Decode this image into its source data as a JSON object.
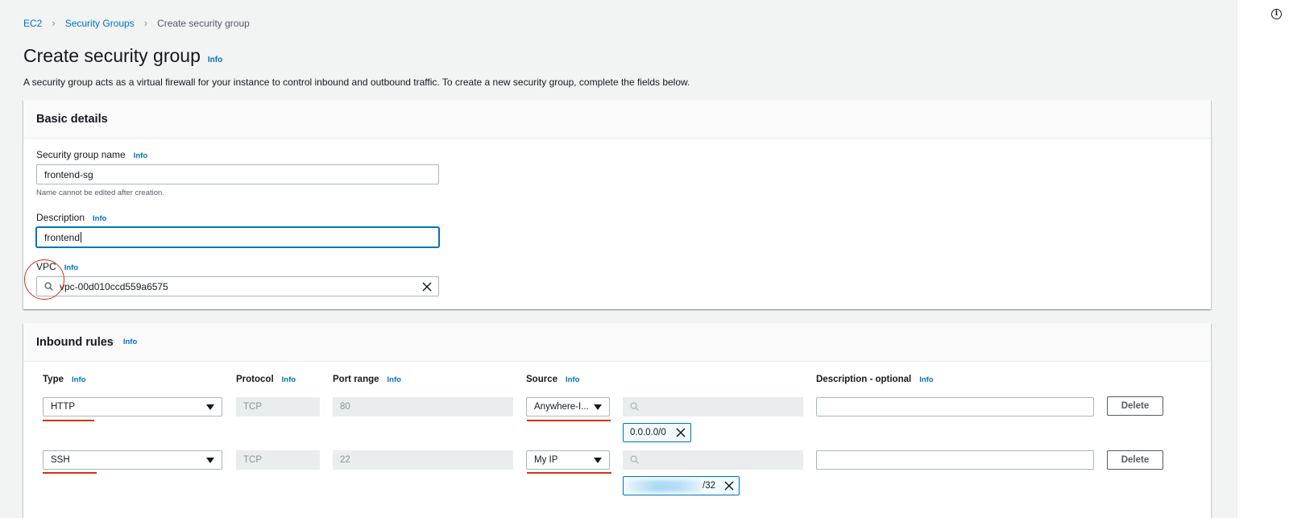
{
  "breadcrumb": {
    "items": [
      "EC2",
      "Security Groups"
    ],
    "current": "Create security group"
  },
  "page": {
    "title": "Create security group",
    "info": "Info",
    "description": "A security group acts as a virtual firewall for your instance to control inbound and outbound traffic. To create a new security group, complete the fields below."
  },
  "basic_details": {
    "heading": "Basic details",
    "name_label": "Security group name",
    "name_info": "Info",
    "name_value": "frontend-sg",
    "name_hint": "Name cannot be edited after creation.",
    "description_label": "Description",
    "description_info": "Info",
    "description_value": "frontend",
    "vpc_label": "VPC",
    "vpc_info": "Info",
    "vpc_value": "vpc-00d010ccd559a6575"
  },
  "inbound": {
    "heading": "Inbound rules",
    "info": "Info",
    "columns": {
      "type": "Type",
      "protocol": "Protocol",
      "port_range": "Port range",
      "source": "Source",
      "description": "Description - optional",
      "info": "Info"
    },
    "rules": [
      {
        "type": "HTTP",
        "protocol": "TCP",
        "port": "80",
        "source": "Anywhere-I...",
        "cidr": "0.0.0.0/0",
        "delete": "Delete"
      },
      {
        "type": "SSH",
        "protocol": "TCP",
        "port": "22",
        "source": "My IP",
        "cidr": "/32",
        "delete": "Delete"
      }
    ]
  },
  "colors": {
    "link": "#0073bb",
    "annotation": "#d13212",
    "background": "#f2f3f3"
  },
  "icons": [
    "chevron-right-icon",
    "search-icon",
    "clear-icon",
    "caret-down-icon",
    "info-circle-icon"
  ]
}
